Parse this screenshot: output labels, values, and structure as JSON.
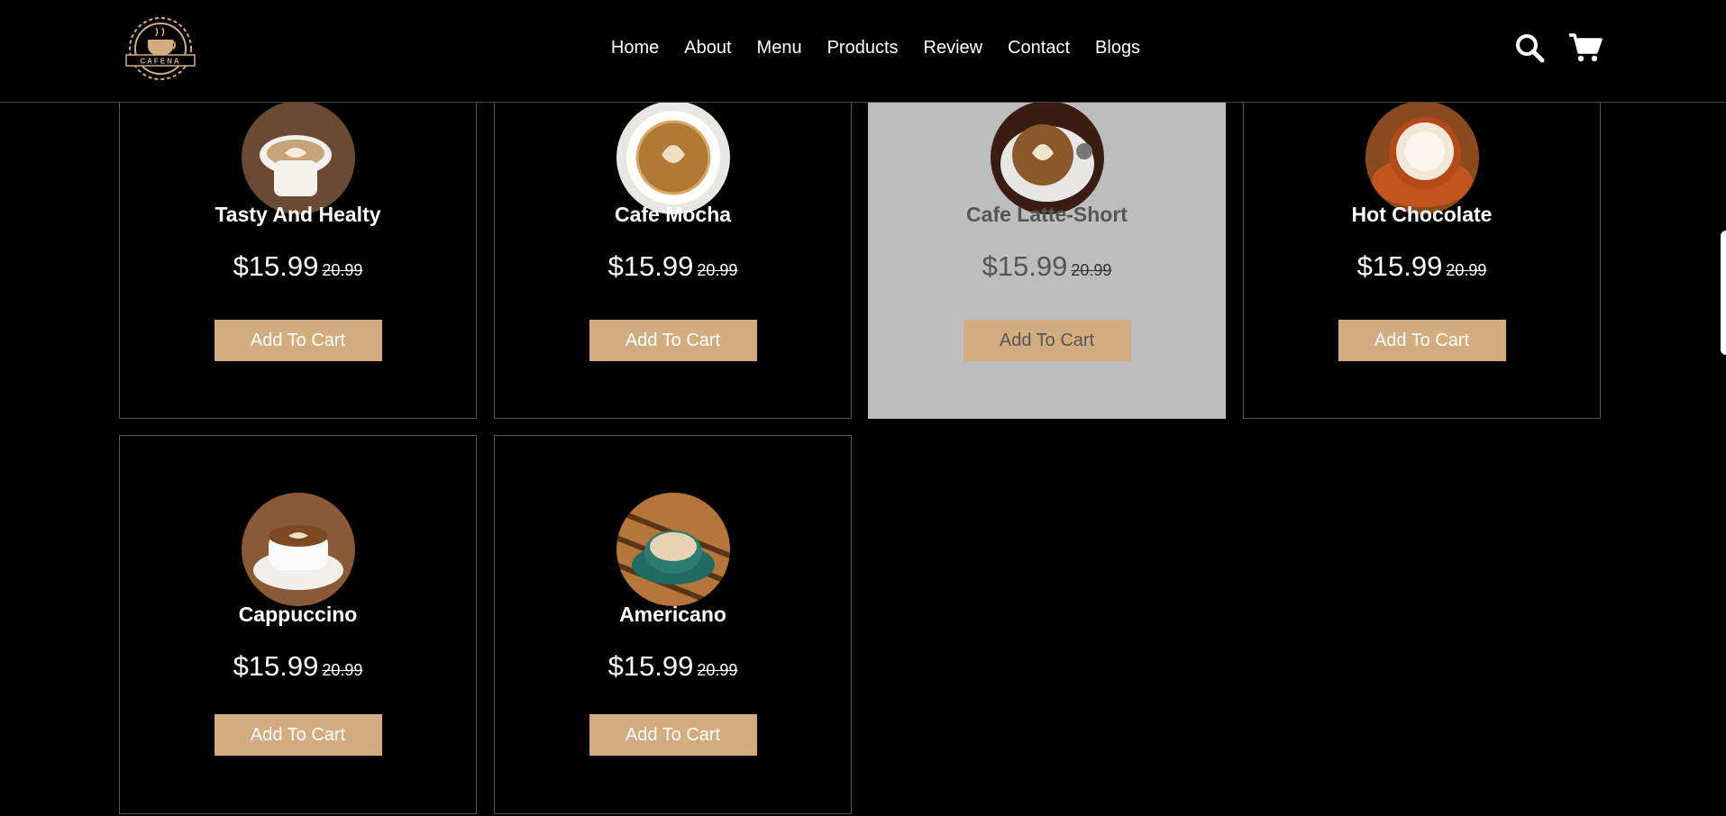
{
  "brand": {
    "logo_text": "CAFENA"
  },
  "nav": {
    "items": [
      {
        "label": "Home"
      },
      {
        "label": "About"
      },
      {
        "label": "Menu"
      },
      {
        "label": "Products"
      },
      {
        "label": "Review"
      },
      {
        "label": "Contact"
      },
      {
        "label": "Blogs"
      }
    ]
  },
  "header_icons": [
    "search-icon",
    "cart-icon"
  ],
  "products": [
    {
      "name": "Tasty And Healty",
      "price": "$15.99",
      "old_price": "20.99",
      "button": "Add To Cart"
    },
    {
      "name": "Cafe Mocha",
      "price": "$15.99",
      "old_price": "20.99",
      "button": "Add To Cart"
    },
    {
      "name": "Cafe Latte-Short",
      "price": "$15.99",
      "old_price": "20.99",
      "button": "Add To Cart"
    },
    {
      "name": "Hot Chocolate",
      "price": "$15.99",
      "old_price": "20.99",
      "button": "Add To Cart"
    },
    {
      "name": "Cappuccino",
      "price": "$15.99",
      "old_price": "20.99",
      "button": "Add To Cart"
    },
    {
      "name": "Americano",
      "price": "$15.99",
      "old_price": "20.99",
      "button": "Add To Cart"
    }
  ],
  "colors": {
    "accent": "#d3ad7f",
    "background": "#000000",
    "hover_card": "#bdbdbd"
  }
}
